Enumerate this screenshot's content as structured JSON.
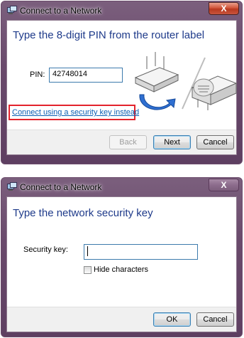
{
  "dialog1": {
    "title": "Connect to a Network",
    "heading": "Type the 8-digit PIN from the router label",
    "pin_label": "PIN:",
    "pin_value": "42748014",
    "link": "Connect using a security key instead",
    "buttons": {
      "back": "Back",
      "next": "Next",
      "cancel": "Cancel"
    },
    "close_label": "X"
  },
  "dialog2": {
    "title": "Connect to a Network",
    "heading": "Type the network security key",
    "key_label": "Security key:",
    "key_value": "",
    "checkbox_label": "Hide characters",
    "checkbox_checked": false,
    "buttons": {
      "ok": "OK",
      "cancel": "Cancel"
    },
    "close_label": "X"
  },
  "colors": {
    "heading": "#1e3a8a",
    "link": "#0b5fb3",
    "highlight": "#e3232c",
    "close_red": "#c9402a"
  },
  "icons": [
    "network-app-icon",
    "router-arrow-illustration"
  ]
}
